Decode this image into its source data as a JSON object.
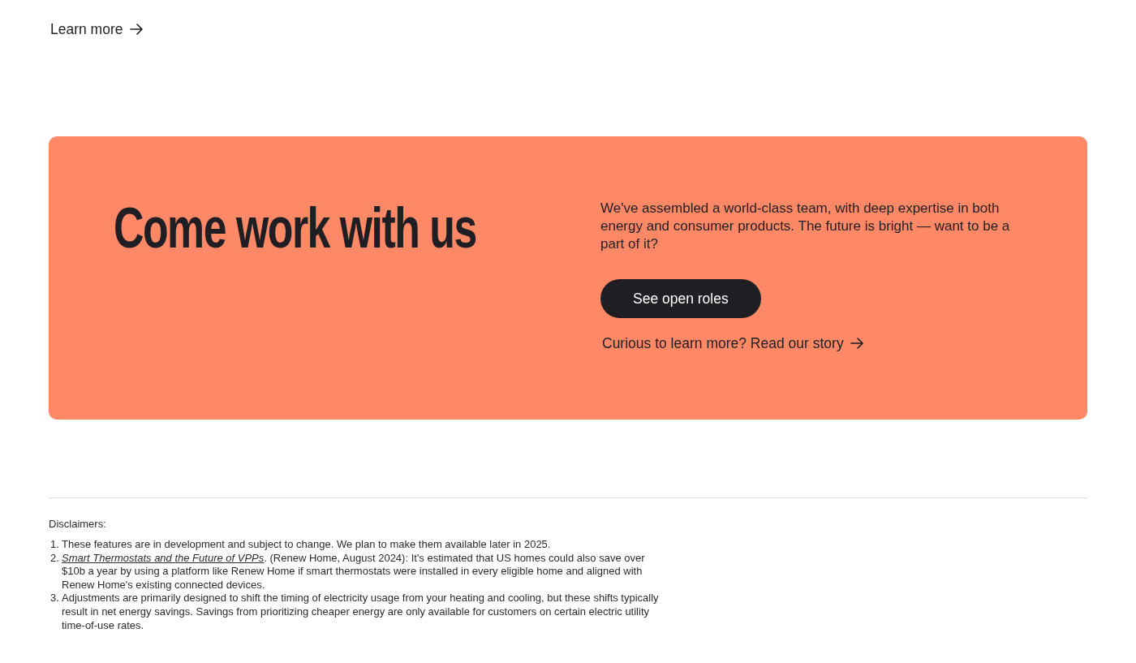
{
  "intro_link": {
    "label": "Learn more"
  },
  "careers_banner": {
    "heading": "Come work with us",
    "body": "We've assembled a world-class team, with deep expertise in both energy and consumer products. The future is bright — want to be a part of it?",
    "button": "See open roles",
    "story_link": "Curious to learn more? Read our story"
  },
  "disclaimers": {
    "title": "Disclaimers:",
    "items": [
      {
        "number": "1.",
        "text": "These features are in development and subject to change. We plan to make them available later in 2025."
      },
      {
        "number": "2.",
        "link": "Smart Thermostats and the Future of VPPs",
        "text": ". (Renew Home, August 2024): It's estimated that US homes could also save over $10b a year by using a platform like Renew Home if smart thermostats were installed in every eligible home and aligned with Renew Home's existing connected devices."
      },
      {
        "number": "3.",
        "text": "Adjustments are primarily designed to shift the timing of electricity usage from your heating and cooling, but these shifts typically result in net energy savings. Savings from prioritizing cheaper energy are only available for customers on certain electric utility time-of-use rates."
      }
    ]
  }
}
